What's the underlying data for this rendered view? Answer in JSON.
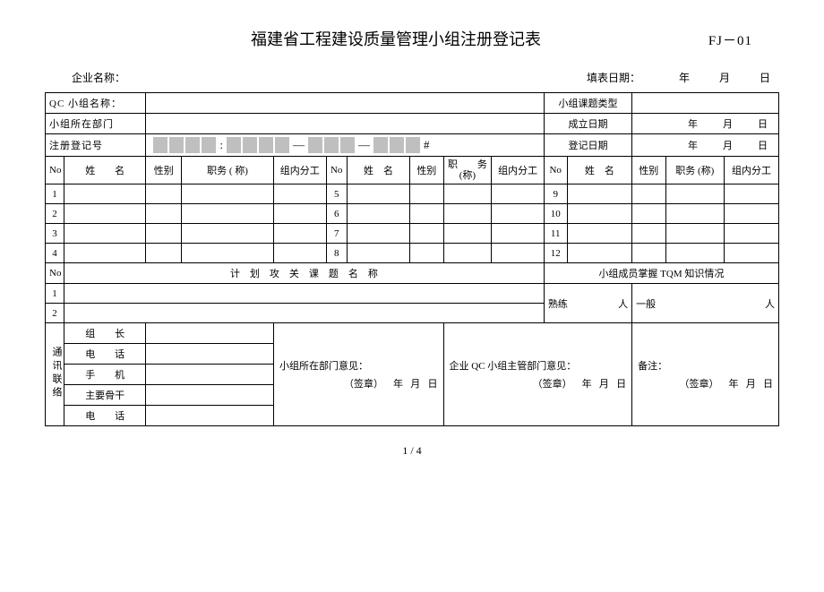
{
  "header": {
    "title": "福建省工程建设质量管理小组注册登记表",
    "code": "FJ－01"
  },
  "topline": {
    "company_label": "企业名称：",
    "fill_label": "填表日期：",
    "y": "年",
    "m": "月",
    "d": "日"
  },
  "rows": {
    "qc_name": "QC 小组名称：",
    "topic_type": "小组课题类型",
    "dept": "小组所在部门",
    "found_date": "成立日期",
    "reg_no": "注册登记号",
    "reg_date": "登记日期",
    "y": "年",
    "m": "月",
    "d": "日",
    "hash": "#"
  },
  "cols": {
    "no": "No",
    "name": "姓　　名",
    "name2": "姓　名",
    "sex": "性别",
    "job1": "职务 ( 称)",
    "job2": "职　　务\n(称)",
    "job3": "职务 (称)",
    "div": "组内分工"
  },
  "members": {
    "nums": [
      1,
      2,
      3,
      4,
      5,
      6,
      7,
      8,
      9,
      10,
      11,
      12
    ]
  },
  "plan": {
    "no": "No",
    "title": "计　划　攻　关　课　题　名　称",
    "tqm": "小组成员掌握 TQM 知识情况",
    "n1": "1",
    "n2": "2",
    "skilled": "熟练",
    "general": "一般",
    "people": "人"
  },
  "contact": {
    "side": "通讯联络",
    "leader": "组　　长",
    "tel": "电　　话",
    "mobile": "手　　机",
    "backbone": "主要骨干",
    "tel2": "电　　话",
    "dept_op": "小组所在部门意见：",
    "qc_op": "企业 QC 小组主管部门意见：",
    "note": "备注：",
    "sig": "（签章）",
    "y": "年",
    "m": "月",
    "d": "日"
  },
  "page": "1 / 4"
}
